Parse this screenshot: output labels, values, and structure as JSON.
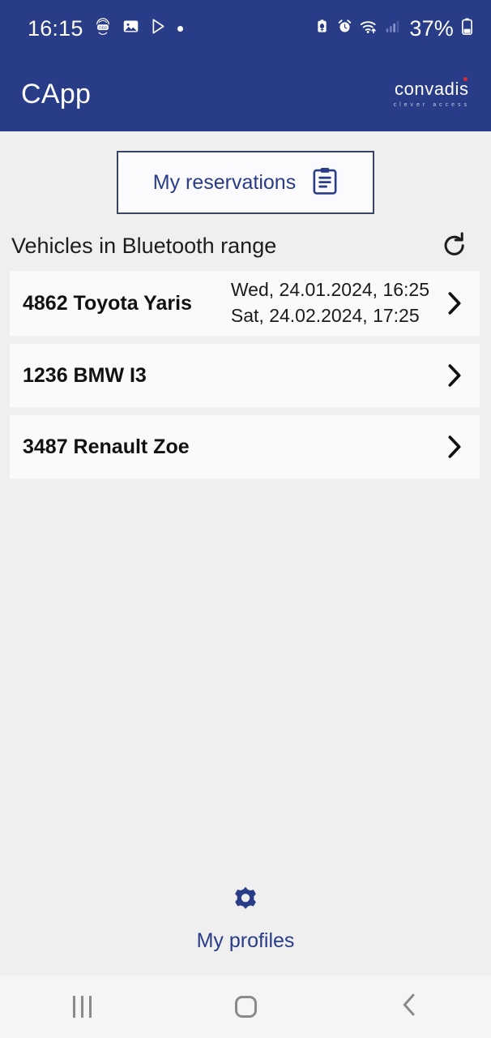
{
  "status_bar": {
    "time": "16:15",
    "battery_percent": "37%",
    "left_icons": [
      "obd-icon",
      "image-icon",
      "play-store-icon",
      "dot-icon"
    ],
    "right_icons": [
      "battery-saver-icon",
      "alarm-icon",
      "wifi-icon",
      "signal-icon",
      "battery-icon"
    ]
  },
  "app_bar": {
    "title": "CApp",
    "logo_word": "convadis",
    "logo_tagline": "clever access",
    "background_color": "#283c87",
    "logo_dot_color": "#d92d3c"
  },
  "reservations_button": {
    "label": "My reservations",
    "icon": "clipboard-icon",
    "text_color": "#283c87",
    "border_color": "#3a4466"
  },
  "section": {
    "title": "Vehicles in Bluetooth range",
    "refresh_icon": "refresh-icon"
  },
  "vehicles": [
    {
      "name": "4862 Toyota Yaris",
      "date_from": "Wed, 24.01.2024, 16:25",
      "date_to": "Sat, 24.02.2024, 17:25",
      "chevron": "chevron-right-icon"
    },
    {
      "name": "1236 BMW I3",
      "date_from": "",
      "date_to": "",
      "chevron": "chevron-right-icon"
    },
    {
      "name": "3487 Renault Zoe",
      "date_from": "",
      "date_to": "",
      "chevron": "chevron-right-icon"
    }
  ],
  "profiles": {
    "label": "My profiles",
    "icon": "gear-icon",
    "color": "#283c87"
  },
  "nav_bar": {
    "recents": "recents-icon",
    "home": "home-icon",
    "back": "back-icon"
  }
}
